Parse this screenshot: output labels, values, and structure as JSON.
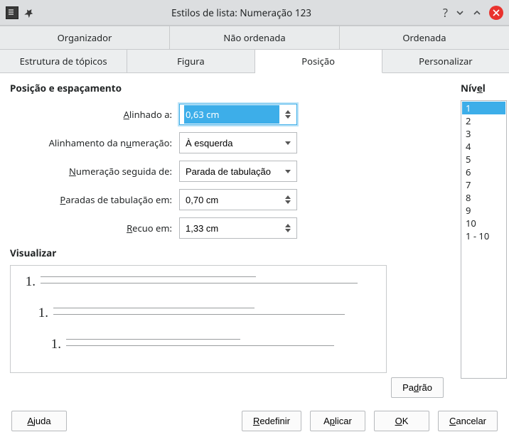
{
  "titlebar": {
    "title": "Estilos de lista: Numeração 123"
  },
  "tabs_row1": {
    "t0": "Organizador",
    "t1": "Não ordenada",
    "t2": "Ordenada"
  },
  "tabs_row2": {
    "t0": "Estrutura de tópicos",
    "t1": "Figura",
    "t2": "Posição",
    "t3": "Personalizar"
  },
  "section": {
    "heading": "Posição e espaçamento",
    "labels": {
      "aligned_prefix": "A",
      "aligned_suffix": "linhado a:",
      "numalign_prefix": "Alinhamento da n",
      "numalign_suffix": "umeração:",
      "followed_prefix": "N",
      "followed_suffix": "umeração seguida de:",
      "tabstops_prefix": "P",
      "tabstops_suffix": "aradas de tabulação em:",
      "indent_prefix": "R",
      "indent_suffix": "ecuo em:"
    },
    "values": {
      "aligned": "0,63 cm",
      "numalign": "À esquerda",
      "followed": "Parada de tabulação",
      "tabstops": "0,70 cm",
      "indent": "1,33 cm"
    },
    "preview_heading": "Visualizar",
    "preview_numbers": {
      "n1": "1.",
      "n2": "1.",
      "n3": "1."
    },
    "default_btn_pre": "Pa",
    "default_btn_u": "d",
    "default_btn_post": "rão"
  },
  "level": {
    "heading_pre": "Nív",
    "heading_u": "e",
    "heading_post": "l",
    "items": {
      "i0": "1",
      "i1": "2",
      "i2": "3",
      "i3": "4",
      "i4": "5",
      "i5": "6",
      "i6": "7",
      "i7": "8",
      "i8": "9",
      "i9": "10",
      "i10": "1 - 10"
    }
  },
  "footer": {
    "help_u": "A",
    "help_post": "juda",
    "reset_u": "R",
    "reset_post": "edefinir",
    "apply_pre": "A",
    "apply_u": "p",
    "apply_post": "licar",
    "ok_u": "O",
    "ok_post": "K",
    "cancel_u": "C",
    "cancel_post": "ancelar"
  }
}
